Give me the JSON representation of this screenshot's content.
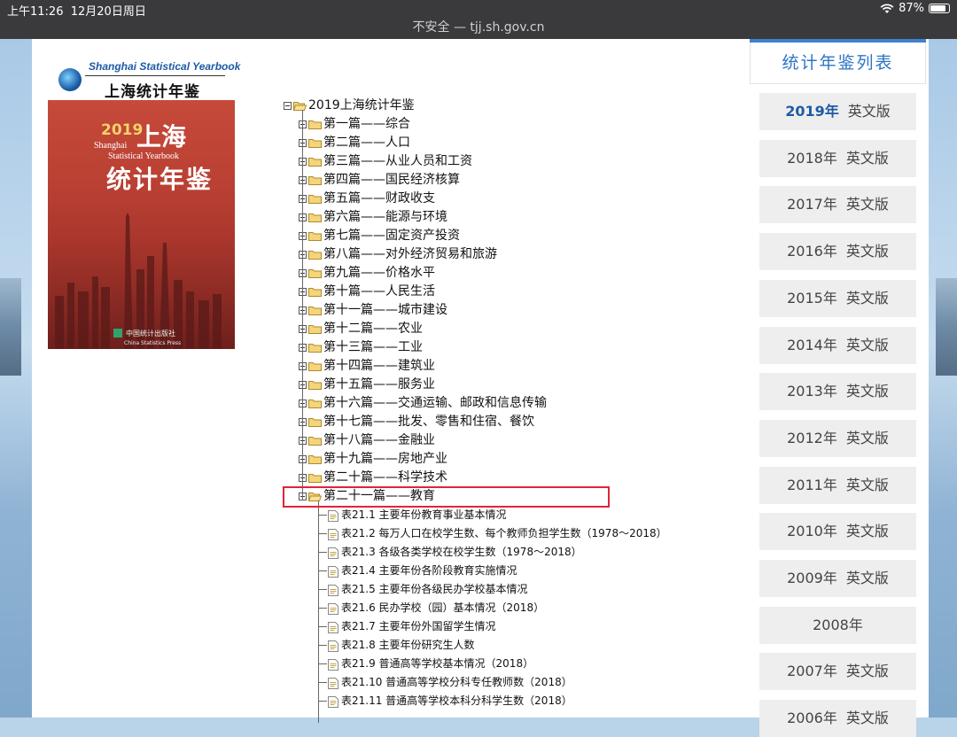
{
  "status": {
    "time": "上午11:26",
    "date": "12月20日周日",
    "battery": "87%",
    "battery_level": 0.87
  },
  "browser": {
    "url": "不安全 — tjj.sh.gov.cn"
  },
  "brand": {
    "en": "Shanghai Statistical Yearbook",
    "cn": "上海统计年鉴"
  },
  "cover": {
    "year": "2019",
    "title1": "上海",
    "sh": "Shanghai",
    "sy": "Statistical Yearbook",
    "title2": "统计年鉴",
    "publisher": "中国统计出版社",
    "publisher_en": "China Statistics Press"
  },
  "tree": {
    "root": "2019上海统计年鉴",
    "chapters": [
      "第一篇——综合",
      "第二篇——人口",
      "第三篇——从业人员和工资",
      "第四篇——国民经济核算",
      "第五篇——财政收支",
      "第六篇——能源与环境",
      "第七篇——固定资产投资",
      "第八篇——对外经济贸易和旅游",
      "第九篇——价格水平",
      "第十篇——人民生活",
      "第十一篇——城市建设",
      "第十二篇——农业",
      "第十三篇——工业",
      "第十四篇——建筑业",
      "第十五篇——服务业",
      "第十六篇——交通运输、邮政和信息传输",
      "第十七篇——批发、零售和住宿、餐饮",
      "第十八篇——金融业",
      "第十九篇——房地产业",
      "第二十篇——科学技术",
      "第二十一篇——教育"
    ],
    "tables": [
      "表21.1 主要年份教育事业基本情况",
      "表21.2 每万人口在校学生数、每个教师负担学生数（1978～2018）",
      "表21.3 各级各类学校在校学生数（1978～2018）",
      "表21.4 主要年份各阶段教育实施情况",
      "表21.5 主要年份各级民办学校基本情况",
      "表21.6 民办学校（园）基本情况（2018）",
      "表21.7 主要年份外国留学生情况",
      "表21.8 主要年份研究生人数",
      "表21.9 普通高等学校基本情况（2018）",
      "表21.10 普通高等学校分科专任教师数（2018）",
      "表21.11 普通高等学校本科分科学生数（2018）"
    ]
  },
  "sidebar": {
    "title": "统计年鉴列表",
    "items": [
      {
        "year": "2019年",
        "en": "英文版",
        "active": true
      },
      {
        "year": "2018年",
        "en": "英文版"
      },
      {
        "year": "2017年",
        "en": "英文版"
      },
      {
        "year": "2016年",
        "en": "英文版"
      },
      {
        "year": "2015年",
        "en": "英文版"
      },
      {
        "year": "2014年",
        "en": "英文版"
      },
      {
        "year": "2013年",
        "en": "英文版"
      },
      {
        "year": "2012年",
        "en": "英文版"
      },
      {
        "year": "2011年",
        "en": "英文版"
      },
      {
        "year": "2010年",
        "en": "英文版"
      },
      {
        "year": "2009年",
        "en": "英文版"
      },
      {
        "year": "2008年",
        "en": ""
      },
      {
        "year": "2007年",
        "en": "英文版"
      },
      {
        "year": "2006年",
        "en": "英文版"
      }
    ]
  }
}
